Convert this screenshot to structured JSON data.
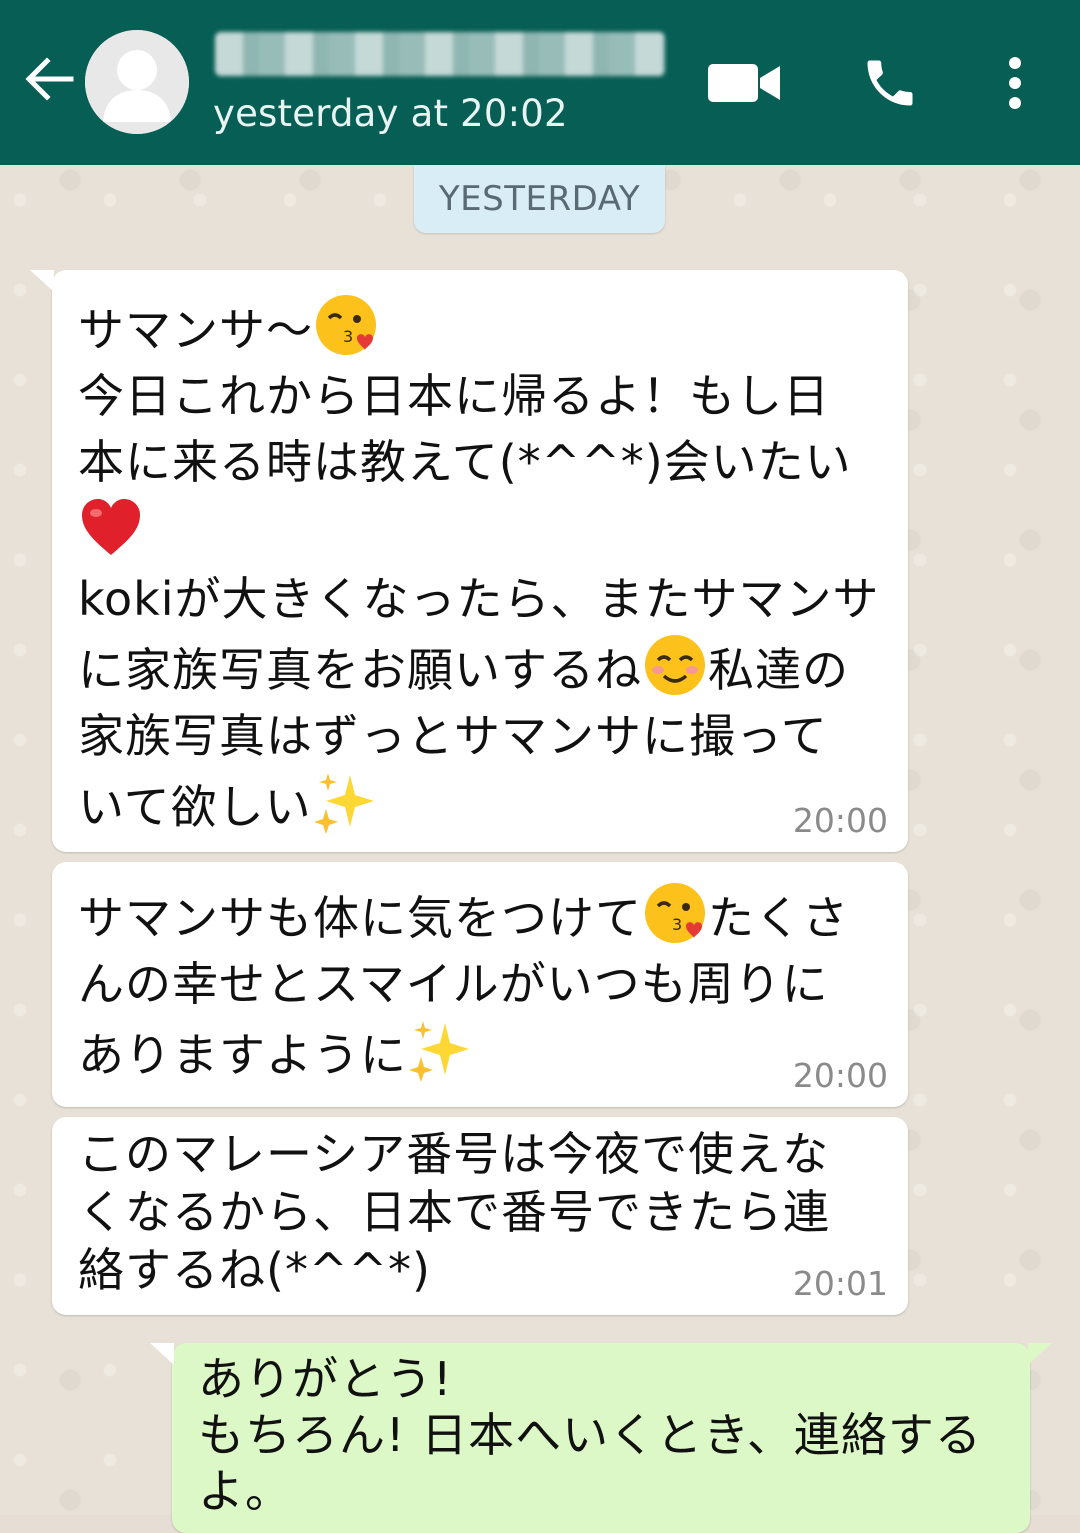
{
  "header": {
    "contact_name": "",
    "last_seen": "yesterday at 20:02",
    "background": "#075e54",
    "icons": [
      "back-arrow-icon",
      "avatar-icon",
      "video-call-icon",
      "phone-icon",
      "more-vert-icon"
    ]
  },
  "date_divider": "YESTERDAY",
  "messages": [
    {
      "direction": "in",
      "time": "20:00",
      "lines": [
        {
          "parts": [
            "サマンサ〜"
          ],
          "emoji_after": "kissing-face-heart-emoji"
        },
        {
          "parts": [
            "今日これから日本に帰るよ！もし日"
          ]
        },
        {
          "parts": [
            "本に来る時は教えて(*^^*)会いたい"
          ]
        },
        {
          "parts": [
            ""
          ],
          "emoji_after": "red-heart-emoji"
        },
        {
          "parts": [
            "kokiが大きくなったら、またサマンサ"
          ]
        },
        {
          "parts": [
            "に家族写真をお願いするね",
            "私達の"
          ],
          "emoji_between": "smiling-blush-emoji"
        },
        {
          "parts": [
            "家族写真はずっとサマンサに撮って"
          ]
        },
        {
          "parts": [
            "いて欲しい"
          ],
          "emoji_after": "sparkles-emoji"
        }
      ]
    },
    {
      "direction": "in",
      "time": "20:00",
      "lines": [
        {
          "parts": [
            "サマンサも体に気をつけて",
            "たくさ"
          ],
          "emoji_between": "kissing-face-heart-emoji"
        },
        {
          "parts": [
            "んの幸せとスマイルがいつも周りに"
          ]
        },
        {
          "parts": [
            "ありますように"
          ],
          "emoji_after": "sparkles-emoji"
        }
      ]
    },
    {
      "direction": "in",
      "time": "20:01",
      "lines": [
        {
          "parts": [
            "このマレーシア番号は今夜で使えな"
          ]
        },
        {
          "parts": [
            "くなるから、日本で番号できたら連"
          ]
        },
        {
          "parts": [
            "絡するね(*^^*)"
          ]
        }
      ]
    },
    {
      "direction": "out",
      "time": "",
      "lines": [
        {
          "parts": [
            "ありがとう!"
          ]
        },
        {
          "parts": [
            "もちろん! 日本へいくとき、連絡する"
          ]
        },
        {
          "parts": [
            "よ。"
          ]
        }
      ]
    }
  ],
  "colors": {
    "header": "#075e54",
    "incoming_bubble": "#ffffff",
    "outgoing_bubble": "#dcf8c6",
    "date_pill": "#d9edf7",
    "wallpaper": "#e8e1d7"
  }
}
